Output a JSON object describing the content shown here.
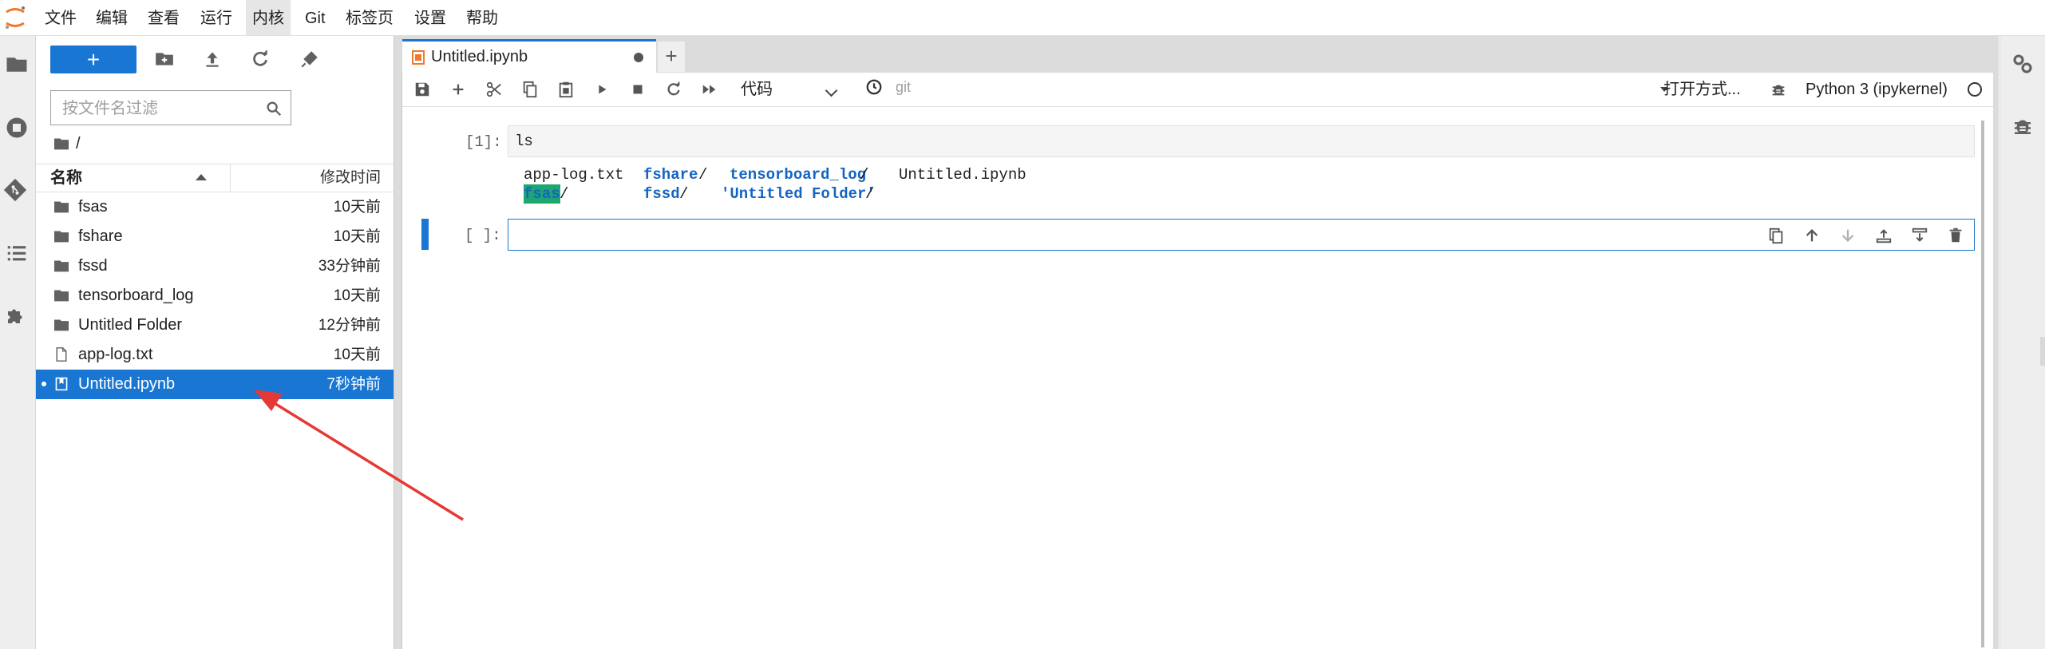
{
  "menubar": {
    "items": [
      "文件",
      "编辑",
      "查看",
      "运行",
      "内核",
      "Git",
      "标签页",
      "设置",
      "帮助"
    ],
    "active_index": 4
  },
  "leftbar": {
    "icons": [
      "folder-icon",
      "running-icon",
      "git-icon",
      "toc-icon",
      "extension-icon"
    ]
  },
  "rightbar": {
    "icons": [
      "property-inspector-icon",
      "debugger-icon"
    ]
  },
  "filebrowser": {
    "new_label": "+",
    "filter_placeholder": "按文件名过滤",
    "breadcrumb": "/",
    "header_name": "名称",
    "header_modified": "修改时间",
    "files": [
      {
        "name": "fsas",
        "modified": "10天前",
        "type": "folder"
      },
      {
        "name": "fshare",
        "modified": "10天前",
        "type": "folder"
      },
      {
        "name": "fssd",
        "modified": "33分钟前",
        "type": "folder"
      },
      {
        "name": "tensorboard_log",
        "modified": "10天前",
        "type": "folder"
      },
      {
        "name": "Untitled Folder",
        "modified": "12分钟前",
        "type": "folder"
      },
      {
        "name": "app-log.txt",
        "modified": "10天前",
        "type": "file"
      },
      {
        "name": "Untitled.ipynb",
        "modified": "7秒钟前",
        "type": "notebook",
        "selected": true
      }
    ]
  },
  "tabs": {
    "doc_tab_label": "Untitled.ipynb",
    "add_tab_label": "+"
  },
  "notebook_toolbar": {
    "cell_type": "代码",
    "git_label": "git",
    "open_with": "打开方式...",
    "kernel": "Python 3 (ipykernel)"
  },
  "cells": {
    "cell1_prompt": "[1]:",
    "cell1_source": "ls",
    "output_row1": {
      "c1": "app-log.txt",
      "c2": "fshare",
      "c2_sep": "/",
      "c3": "tensorboard_log",
      "c3_sep": "/",
      "c4": "Untitled.ipynb"
    },
    "output_row2": {
      "c1": "fsas",
      "c1_sep": "/",
      "c2": "fssd",
      "c2_sep": "/",
      "c3": "'Untitled Folder'",
      "c3_sep": "/"
    },
    "cell2_prompt": "[ ]:"
  },
  "colors": {
    "accent": "#1976d2",
    "annotation_arrow": "#e53935",
    "output_highlight": "#1ea672"
  }
}
